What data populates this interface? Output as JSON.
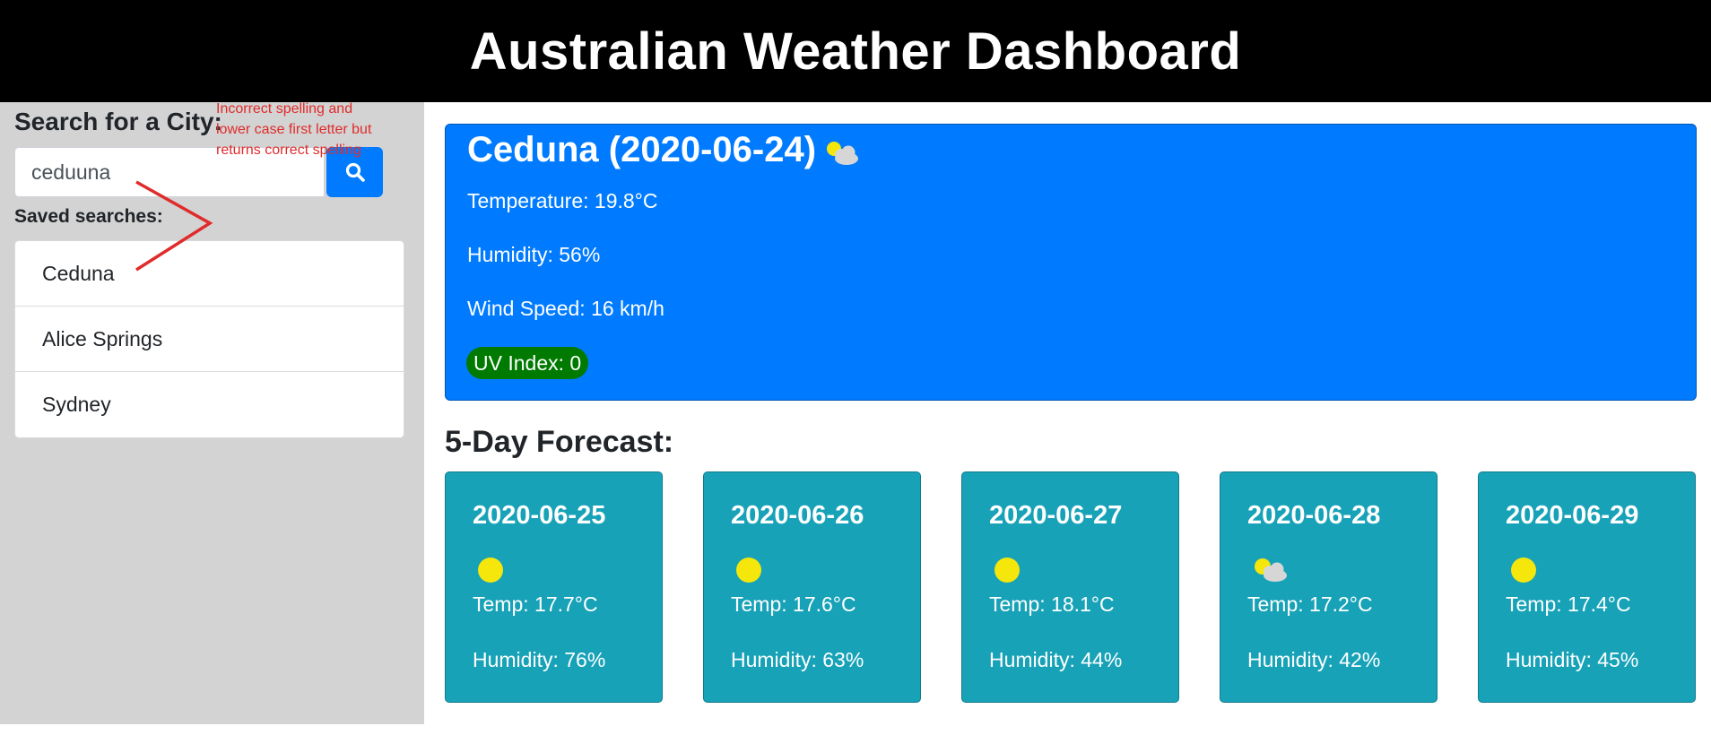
{
  "header": {
    "title": "Australian Weather Dashboard"
  },
  "sidebar": {
    "search_heading": "Search for a City:",
    "search_value": "ceduuna",
    "search_button_icon": "search-icon",
    "saved_label": "Saved searches:",
    "saved_items": [
      {
        "label": "Ceduna"
      },
      {
        "label": "Alice Springs"
      },
      {
        "label": "Sydney"
      }
    ]
  },
  "annotation": {
    "text": "Incorrect spelling and lower case first letter but returns correct spelling",
    "color": "#e02b2b"
  },
  "current": {
    "title": "Ceduna (2020-06-24)",
    "icon": "partly-cloudy-icon",
    "temperature": "Temperature: 19.8°C",
    "humidity": "Humidity: 56%",
    "wind": "Wind Speed: 16 km/h",
    "uv": "UV Index: 0",
    "card_color": "#007bff",
    "uv_color": "#007a00"
  },
  "forecast": {
    "title": "5-Day Forecast:",
    "card_color": "#17a2b8",
    "days": [
      {
        "date": "2020-06-25",
        "icon": "sun-icon",
        "temp": "Temp: 17.7°C",
        "humidity": "Humidity: 76%"
      },
      {
        "date": "2020-06-26",
        "icon": "sun-icon",
        "temp": "Temp: 17.6°C",
        "humidity": "Humidity: 63%"
      },
      {
        "date": "2020-06-27",
        "icon": "sun-icon",
        "temp": "Temp: 18.1°C",
        "humidity": "Humidity: 44%"
      },
      {
        "date": "2020-06-28",
        "icon": "partly-cloudy-icon",
        "temp": "Temp: 17.2°C",
        "humidity": "Humidity: 42%"
      },
      {
        "date": "2020-06-29",
        "icon": "sun-icon",
        "temp": "Temp: 17.4°C",
        "humidity": "Humidity: 45%"
      }
    ]
  }
}
